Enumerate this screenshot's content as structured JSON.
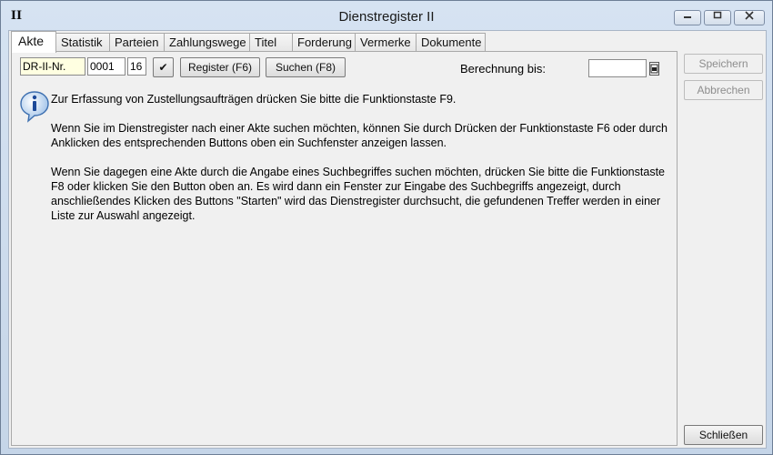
{
  "window": {
    "title": "Dienstregister II",
    "app_icon": "II",
    "controls": {
      "minimize": "minimize-icon",
      "maximize": "maximize-icon",
      "close": "close-icon"
    }
  },
  "tabs": [
    {
      "label": "Akte",
      "active": true
    },
    {
      "label": "Statistik"
    },
    {
      "label": "Parteien"
    },
    {
      "label": "Zahlungswege"
    },
    {
      "label": "Titel"
    },
    {
      "label": "Forderung"
    },
    {
      "label": "Vermerke"
    },
    {
      "label": "Dokumente"
    }
  ],
  "toolbar": {
    "prefix_value": "DR-II-Nr.",
    "number_value": "0001",
    "year_value": "16",
    "check_mark": "✔",
    "register_label": "Register (F6)",
    "search_label": "Suchen (F8)",
    "berechnung_label": "Berechnung bis:",
    "berechnung_value": ""
  },
  "info": {
    "line1": "Zur Erfassung von Zustellungsaufträgen drücken Sie bitte die Funktionstaste F9.",
    "para2": "Wenn Sie im Dienstregister nach einer Akte suchen möchten, können Sie durch Drücken der Funktionstaste F6 oder durch Anklicken des entsprechenden Buttons oben ein Suchfenster anzeigen lassen.",
    "para3": "Wenn Sie dagegen eine Akte durch die Angabe eines Suchbegriffes suchen möchten, drücken Sie bitte die Funktionstaste F8 oder klicken Sie den Button oben an. Es wird dann ein Fenster zur Eingabe des Suchbegriffs angezeigt, durch anschließendes Klicken des Buttons \"Starten\" wird das Dienstregister durchsucht, die gefundenen Treffer werden in einer Liste zur Auswahl angezeigt."
  },
  "sidebar": {
    "save_label": "Speichern",
    "cancel_label": "Abbrechen",
    "close_label": "Schließen"
  }
}
